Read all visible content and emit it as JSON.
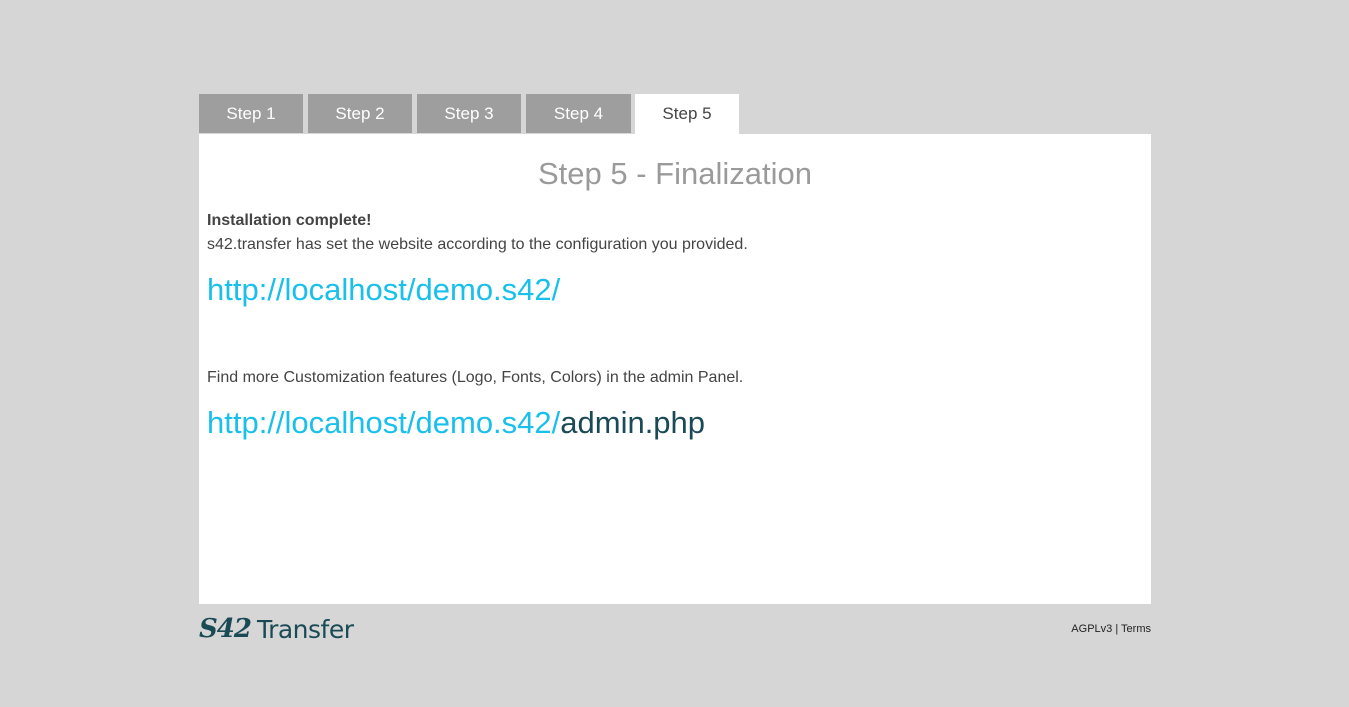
{
  "tabs": [
    {
      "label": "Step 1"
    },
    {
      "label": "Step 2"
    },
    {
      "label": "Step 3"
    },
    {
      "label": "Step 4"
    },
    {
      "label": "Step 5",
      "active": true
    }
  ],
  "panel": {
    "title": "Step 5 - Finalization",
    "complete_heading": "Installation complete!",
    "description": "s42.transfer has set the website according to the configuration you provided.",
    "site_url": "http://localhost/demo.s42/",
    "more_text": "Find more Customization features (Logo, Fonts, Colors) in the admin Panel.",
    "admin_url_base": "http://localhost/demo.s42/",
    "admin_url_file": "admin.php"
  },
  "footer": {
    "logo_mark": "S42",
    "logo_word": "Transfer",
    "license_label": "AGPLv3",
    "separator": "|",
    "terms_label": "Terms"
  },
  "colors": {
    "page_bg": "#d6d6d6",
    "tab_inactive": "#9e9e9e",
    "link": "#19c0ec",
    "brand": "#1a4a55"
  }
}
